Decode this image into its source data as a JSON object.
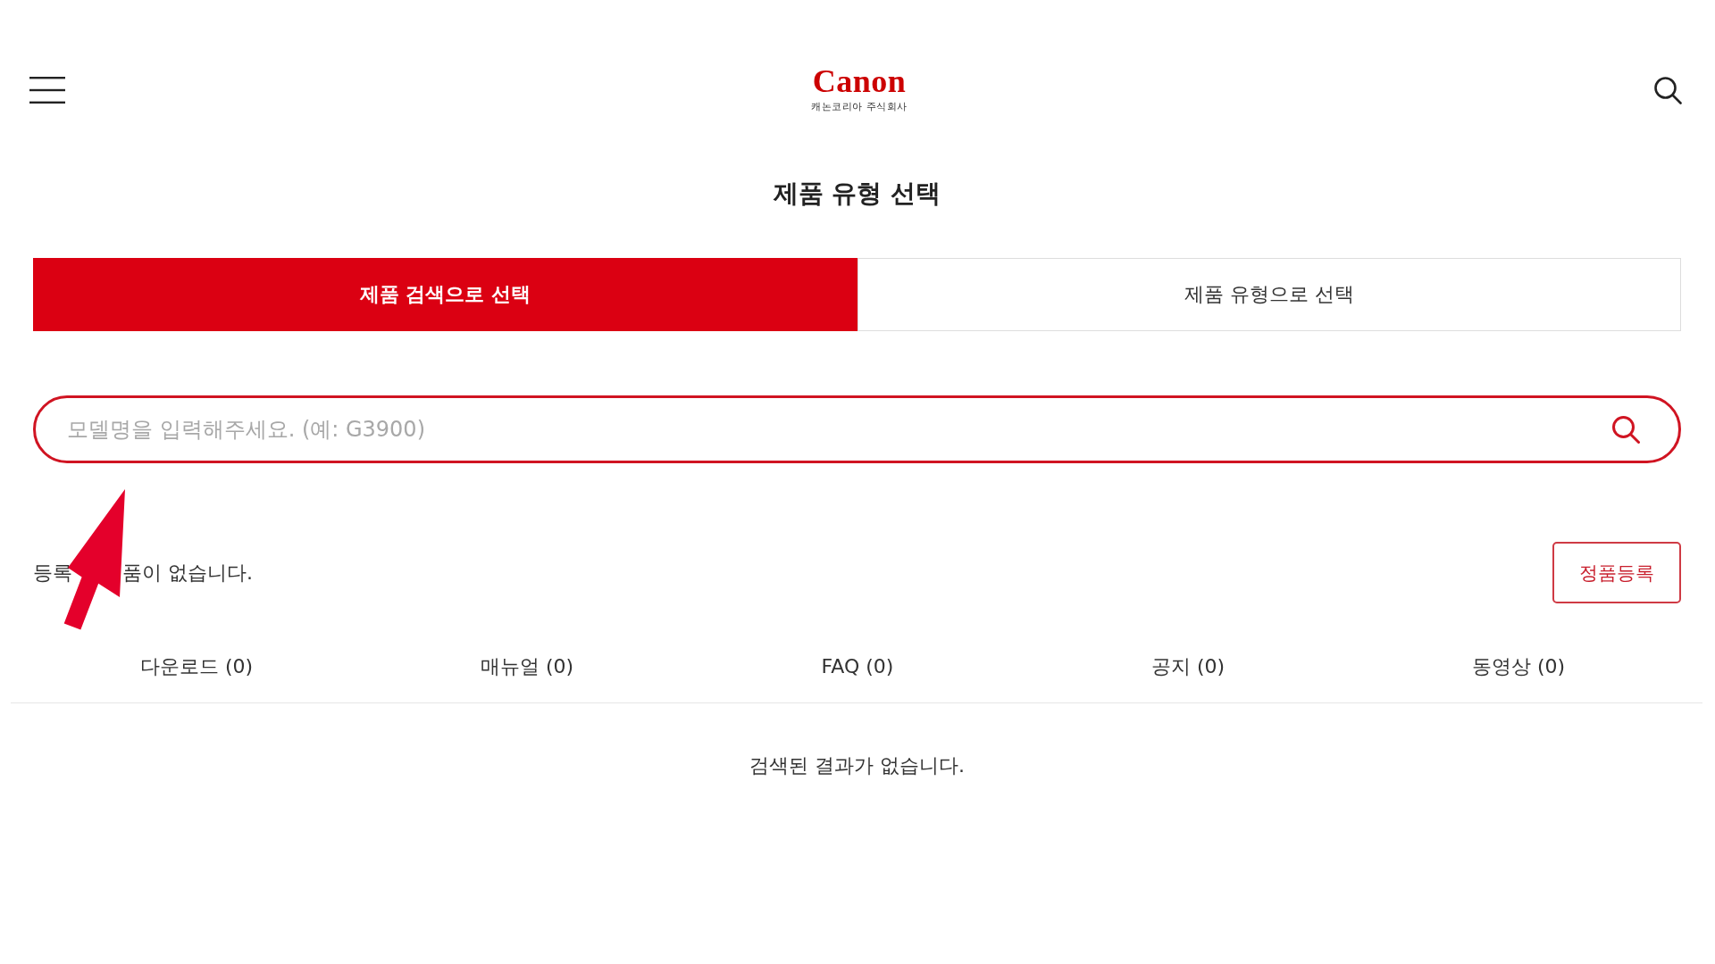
{
  "header": {
    "logo": {
      "wordmark": "Canon",
      "subtitle": "캐논코리아 주식회사"
    }
  },
  "title": "제품 유형 선택",
  "tabs": [
    {
      "label": "제품 검색으로 선택",
      "selected": true
    },
    {
      "label": "제품 유형으로 선택",
      "selected": false
    }
  ],
  "search": {
    "placeholder": "모델명을 입력해주세요. (예: G3900)"
  },
  "registered": {
    "message_visible_parts": [
      "등록",
      "품이 없습니다."
    ],
    "button": "정품등록"
  },
  "categories": [
    {
      "label": "다운로드 (0)",
      "selected": false
    },
    {
      "label": "매뉴얼 (0)",
      "selected": false
    },
    {
      "label": "FAQ (0)",
      "selected": false
    },
    {
      "label": "공지 (0)",
      "selected": false
    },
    {
      "label": "동영상 (0)",
      "selected": false
    }
  ],
  "results": {
    "empty_message": "검색된 결과가 없습니다."
  }
}
